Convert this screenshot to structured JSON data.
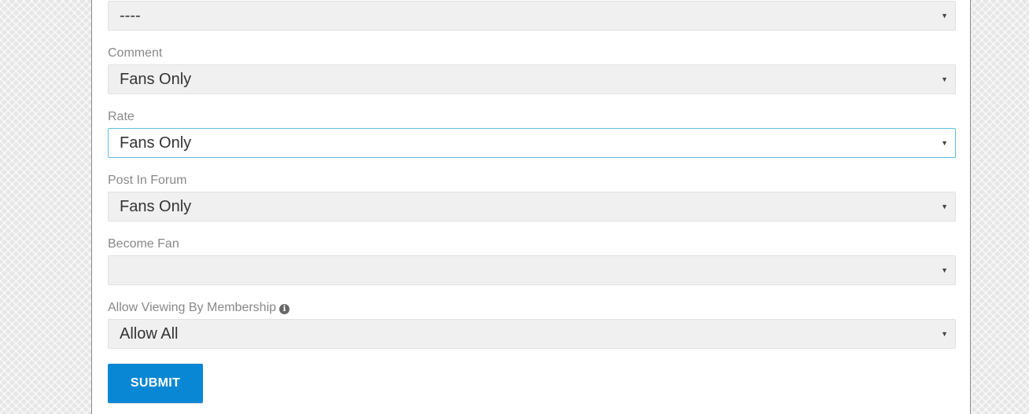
{
  "form": {
    "fields": [
      {
        "label": "",
        "value": "----"
      },
      {
        "label": "Comment",
        "value": "Fans Only"
      },
      {
        "label": "Rate",
        "value": "Fans Only"
      },
      {
        "label": "Post In Forum",
        "value": "Fans Only"
      },
      {
        "label": "Become Fan",
        "value": ""
      },
      {
        "label": "Allow Viewing By Membership",
        "value": "Allow All",
        "info_icon": "info-icon"
      }
    ],
    "focused_field": "Rate",
    "caret_glyph": "▼",
    "info_glyph": "i"
  },
  "submit": {
    "label": "SUBMIT"
  },
  "colors": {
    "accent": "#0a87d4",
    "focus_border": "#5bc0de",
    "select_bg": "#f0f0f0",
    "label_text": "#888888"
  }
}
